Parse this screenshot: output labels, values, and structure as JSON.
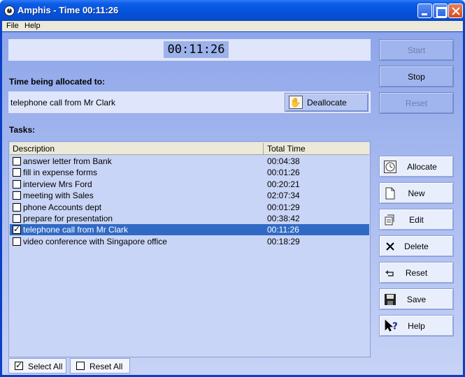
{
  "window": {
    "title": "Amphis - Time 00:11:26"
  },
  "menu": {
    "file": "File",
    "help": "Help"
  },
  "timer": {
    "display": "00:11:26"
  },
  "controls": {
    "start": "Start",
    "stop": "Stop",
    "reset": "Reset"
  },
  "allocation": {
    "heading": "Time being allocated to:",
    "current": "telephone call from Mr Clark",
    "deallocate": "Deallocate"
  },
  "tasks": {
    "heading": "Tasks:",
    "columns": {
      "description": "Description",
      "total_time": "Total Time"
    },
    "rows": [
      {
        "description": "answer letter from Bank",
        "time": "00:04:38",
        "checked": false,
        "selected": false
      },
      {
        "description": "fill in expense forms",
        "time": "00:01:26",
        "checked": false,
        "selected": false
      },
      {
        "description": "interview Mrs Ford",
        "time": "00:20:21",
        "checked": false,
        "selected": false
      },
      {
        "description": "meeting with Sales",
        "time": "02:07:34",
        "checked": false,
        "selected": false
      },
      {
        "description": "phone Accounts dept",
        "time": "00:01:29",
        "checked": false,
        "selected": false
      },
      {
        "description": "prepare for presentation",
        "time": "00:38:42",
        "checked": false,
        "selected": false
      },
      {
        "description": "telephone call from Mr Clark",
        "time": "00:11:26",
        "checked": true,
        "selected": true
      },
      {
        "description": "video conference with Singapore office",
        "time": "00:18:29",
        "checked": false,
        "selected": false
      }
    ]
  },
  "actions": {
    "allocate": "Allocate",
    "new": "New",
    "edit": "Edit",
    "delete": "Delete",
    "reset": "Reset",
    "save": "Save",
    "help": "Help"
  },
  "bottom": {
    "select_all": "Select All",
    "reset_all": "Reset All"
  },
  "colors": {
    "selection": "#316ac5",
    "titlebar": "#0552dd",
    "panel": "#dfe6fb"
  }
}
